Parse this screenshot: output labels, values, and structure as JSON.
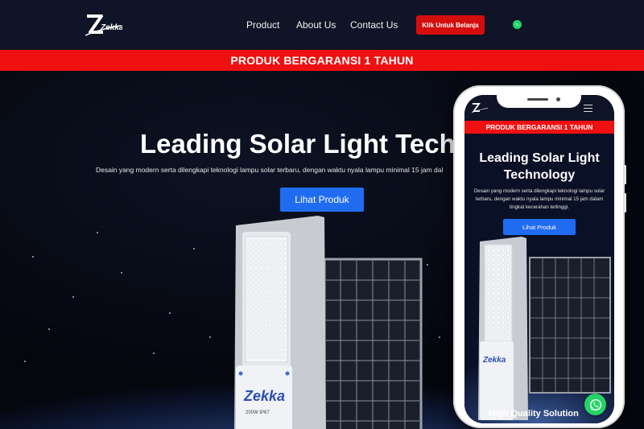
{
  "brand": {
    "logo_text": "Zekka"
  },
  "nav": {
    "items": [
      "Product",
      "About Us",
      "Contact Us"
    ],
    "cta_label": "Klik Untuk Belanja",
    "whatsapp_icon": "whatsapp-icon"
  },
  "banner": {
    "text": "PRODUK BERGARANSI 1 TAHUN"
  },
  "hero": {
    "title": "Leading Solar Light Techno",
    "subtitle": "Desain yang modern serta dilengkapi teknologi lampu solar terbaru, dengan waktu nyala lampu minimal 15 jam dal",
    "button_label": "Lihat Produk",
    "product_label": "Zekka",
    "product_spec": "200W IP67"
  },
  "mobile": {
    "banner_text": "PRODUK BERGARANSI 1 TAHUN",
    "title": "Leading Solar Light Technology",
    "subtitle": "Desain yang modern serta dilengkapi teknologi lampu solar terbaru, dengan waktu nyala lampu minimal 15 jam dalam tingkat kecerahan terlinggi.",
    "button_label": "Lihat Produk",
    "section_heading": "High Quality Solution",
    "product_label": "Zekka"
  },
  "colors": {
    "accent_red": "#ef1111",
    "cta_red": "#d40d0d",
    "button_blue": "#1f6cf0",
    "whatsapp_green": "#25d366",
    "nav_bg": "#0f1426"
  }
}
